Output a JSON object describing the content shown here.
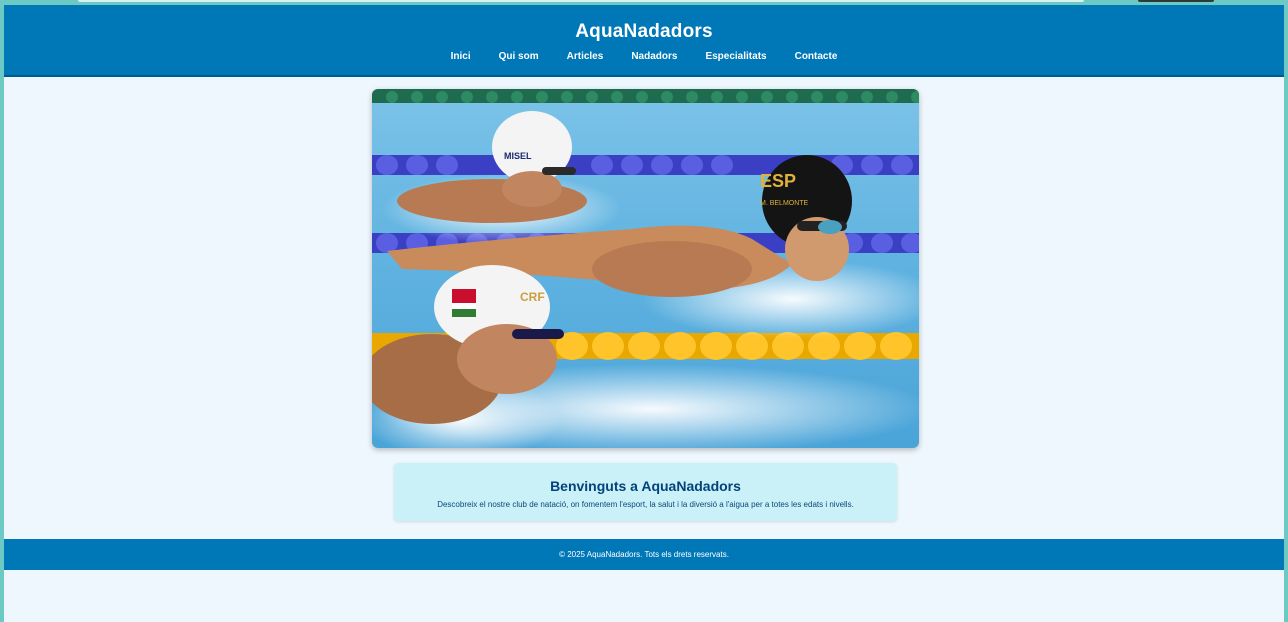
{
  "site": {
    "title": "AquaNadadors"
  },
  "nav": {
    "items": [
      {
        "label": "Inici"
      },
      {
        "label": "Qui som"
      },
      {
        "label": "Articles"
      },
      {
        "label": "Nadadors"
      },
      {
        "label": "Especialitats"
      },
      {
        "label": "Contacte"
      }
    ]
  },
  "hero": {
    "cap_texts": [
      "ESP",
      "M. BELMONTE",
      "MISEL",
      "CRF"
    ]
  },
  "welcome": {
    "heading": "Benvinguts a AquaNadadors",
    "text": "Descobreix el nostre club de natació, on fomentem l'esport, la salut i la diversió a l'aigua per a totes les edats i nivells."
  },
  "footer": {
    "text": "© 2025 AquaNadadors. Tots els drets reservats."
  },
  "colors": {
    "primary": "#0077b6",
    "background": "#eef7fd",
    "card": "#caf0f8",
    "heading": "#03427a"
  }
}
